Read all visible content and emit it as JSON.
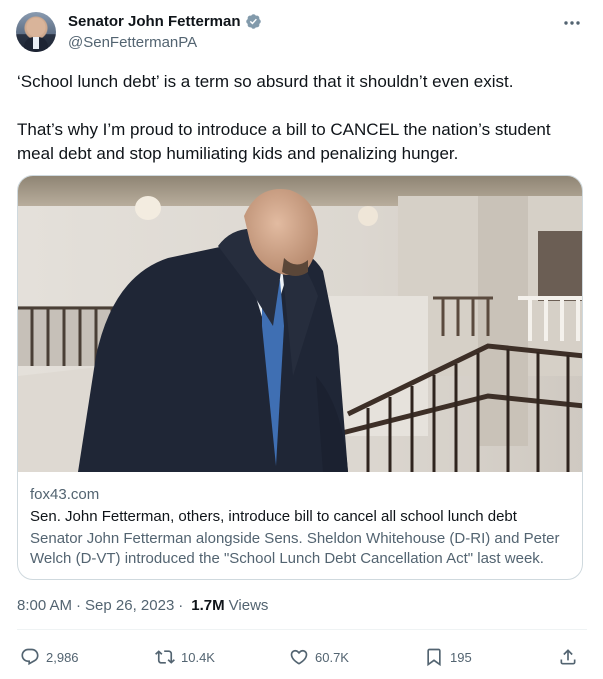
{
  "author": {
    "display_name": "Senator John Fetterman",
    "handle": "@SenFettermanPA",
    "verified_icon": "verified-badge-icon",
    "verified_color": "#829aab"
  },
  "tweet": {
    "paragraphs": [
      "‘School lunch debt’ is a term so absurd that it shouldn’t even exist.",
      "That’s why I’m proud to introduce a bill to CANCEL the nation’s student meal debt and stop humiliating kids and penalizing hunger."
    ]
  },
  "card": {
    "domain": "fox43.com",
    "title": "Sen. John Fetterman, others, introduce bill to cancel all school lunch debt",
    "description": "Senator John Fetterman alongside Sens. Sheldon Whitehouse (D-RI) and Peter Welch (D-VT) introduced the \"School Lunch Debt Cancellation Act\" last week."
  },
  "meta": {
    "time": "8:00 AM",
    "separator": "·",
    "date": "Sep 26, 2023",
    "views_count": "1.7M",
    "views_label": "Views"
  },
  "actions": {
    "replies": "2,986",
    "reposts": "10.4K",
    "likes": "60.7K",
    "bookmarks": "195"
  },
  "colors": {
    "text_primary": "#0f1419",
    "text_secondary": "#536471",
    "border": "#cfd9de"
  }
}
